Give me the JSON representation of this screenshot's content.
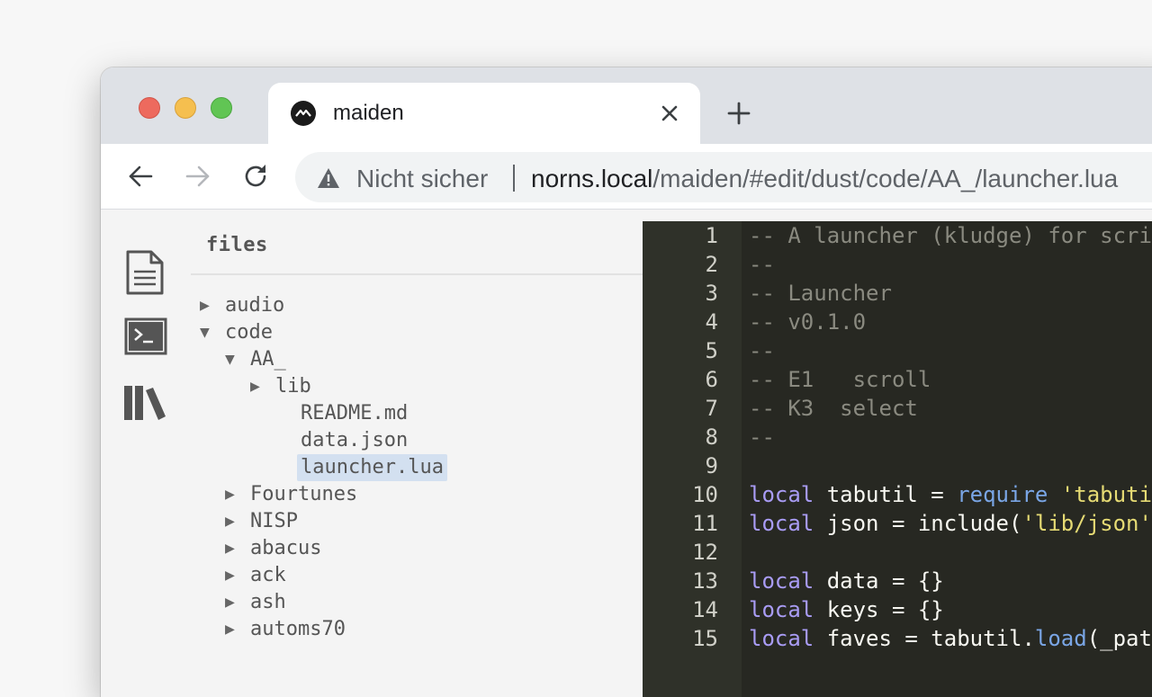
{
  "browser": {
    "tab_title": "maiden",
    "security_label": "Nicht sicher",
    "url_host": "norns.local",
    "url_path": "/maiden/#edit/dust/code/AA_/launcher.lua"
  },
  "sidebar": {
    "icons": [
      "file-icon",
      "terminal-icon",
      "library-icon"
    ]
  },
  "files": {
    "title": "files",
    "tree": [
      {
        "label": "audio",
        "caret": "▶",
        "selected": false
      },
      {
        "label": "code",
        "caret": "▼",
        "selected": false
      },
      {
        "label": "AA_",
        "caret": "▼",
        "selected": false
      },
      {
        "label": "lib",
        "caret": "▶",
        "selected": false
      },
      {
        "label": "README.md",
        "caret": "",
        "selected": false
      },
      {
        "label": "data.json",
        "caret": "",
        "selected": false
      },
      {
        "label": "launcher.lua",
        "caret": "",
        "selected": true
      },
      {
        "label": "Fourtunes",
        "caret": "▶",
        "selected": false
      },
      {
        "label": "NISP",
        "caret": "▶",
        "selected": false
      },
      {
        "label": "abacus",
        "caret": "▶",
        "selected": false
      },
      {
        "label": "ack",
        "caret": "▶",
        "selected": false
      },
      {
        "label": "ash",
        "caret": "▶",
        "selected": false
      },
      {
        "label": "automs70",
        "caret": "▶",
        "selected": false
      }
    ]
  },
  "editor": {
    "lines": [
      {
        "n": "1",
        "tokens": [
          {
            "t": "-- A launcher (kludge) for scri",
            "k": "comment"
          }
        ]
      },
      {
        "n": "2",
        "tokens": [
          {
            "t": "--",
            "k": "comment"
          }
        ]
      },
      {
        "n": "3",
        "tokens": [
          {
            "t": "-- Launcher",
            "k": "comment"
          }
        ]
      },
      {
        "n": "4",
        "tokens": [
          {
            "t": "-- v0.1.0",
            "k": "comment"
          }
        ]
      },
      {
        "n": "5",
        "tokens": [
          {
            "t": "--",
            "k": "comment"
          }
        ]
      },
      {
        "n": "6",
        "tokens": [
          {
            "t": "-- E1   scroll",
            "k": "comment"
          }
        ]
      },
      {
        "n": "7",
        "tokens": [
          {
            "t": "-- K3  select",
            "k": "comment"
          }
        ]
      },
      {
        "n": "8",
        "tokens": [
          {
            "t": "--",
            "k": "comment"
          }
        ]
      },
      {
        "n": "9",
        "tokens": []
      },
      {
        "n": "10",
        "tokens": [
          {
            "t": "local",
            "k": "keyword"
          },
          {
            "t": " tabutil ",
            "k": "plain"
          },
          {
            "t": "=",
            "k": "op"
          },
          {
            "t": " ",
            "k": "plain"
          },
          {
            "t": "require",
            "k": "builtin"
          },
          {
            "t": " ",
            "k": "plain"
          },
          {
            "t": "'tabuti",
            "k": "string"
          }
        ]
      },
      {
        "n": "11",
        "tokens": [
          {
            "t": "local",
            "k": "keyword"
          },
          {
            "t": " json ",
            "k": "plain"
          },
          {
            "t": "=",
            "k": "op"
          },
          {
            "t": " include(",
            "k": "plain"
          },
          {
            "t": "'lib/json'",
            "k": "string"
          }
        ]
      },
      {
        "n": "12",
        "tokens": []
      },
      {
        "n": "13",
        "tokens": [
          {
            "t": "local",
            "k": "keyword"
          },
          {
            "t": " data ",
            "k": "plain"
          },
          {
            "t": "=",
            "k": "op"
          },
          {
            "t": " {}",
            "k": "plain"
          }
        ]
      },
      {
        "n": "14",
        "tokens": [
          {
            "t": "local",
            "k": "keyword"
          },
          {
            "t": " keys ",
            "k": "plain"
          },
          {
            "t": "=",
            "k": "op"
          },
          {
            "t": " {}",
            "k": "plain"
          }
        ]
      },
      {
        "n": "15",
        "tokens": [
          {
            "t": "local",
            "k": "keyword"
          },
          {
            "t": " faves ",
            "k": "plain"
          },
          {
            "t": "=",
            "k": "op"
          },
          {
            "t": " tabutil.",
            "k": "plain"
          },
          {
            "t": "load",
            "k": "builtin"
          },
          {
            "t": "(_pat",
            "k": "plain"
          }
        ]
      }
    ]
  },
  "colors": {
    "titlebar": "#dee1e6",
    "editor_bg": "#272822",
    "selection": "#d3e0f0"
  }
}
